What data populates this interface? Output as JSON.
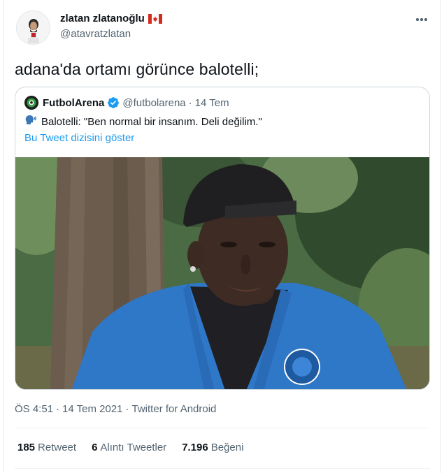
{
  "author": {
    "display_name": "zlatan zlatanoğlu",
    "flag_icon": "canada-flag-icon",
    "handle": "@atavratzlatan"
  },
  "tweet": {
    "text": "adana'da ortamı görünce balotelli;"
  },
  "quoted": {
    "name": "FutbolArena",
    "verified": true,
    "handle": "@futbolarena",
    "separator": "·",
    "date": "14 Tem",
    "speaker_icon": "speaking-head-icon",
    "text": "Balotelli: \"Ben normal bir insanım. Deli değilim.\"",
    "thread_link": "Bu Tweet dizisini göster"
  },
  "meta": {
    "time": "ÖS 4:51",
    "sep1": "·",
    "date": "14 Tem 2021",
    "sep2": "·",
    "source": "Twitter for Android"
  },
  "stats": {
    "retweets_count": "185",
    "retweets_label": "Retweet",
    "quotes_count": "6",
    "quotes_label": "Alıntı Tweetler",
    "likes_count": "7.196",
    "likes_label": "Beğeni"
  },
  "colors": {
    "link": "#1d9bf0",
    "secondary_text": "#536471",
    "border": "#cfd9de"
  }
}
